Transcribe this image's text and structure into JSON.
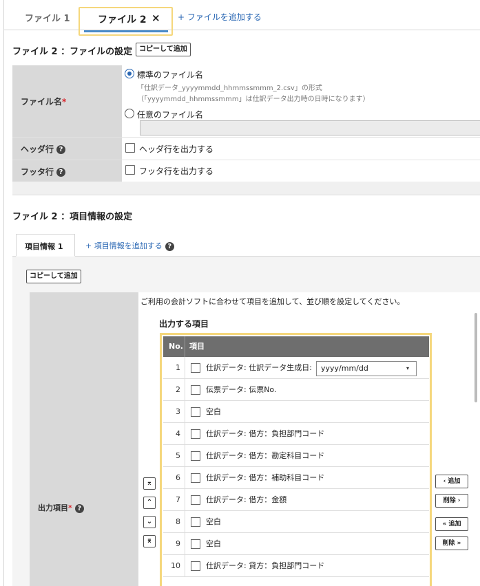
{
  "file_tabs": {
    "tab1": "ファイル 1",
    "tab2": "ファイル 2",
    "close_glyph": "×",
    "add_file": "+ ファイルを追加する"
  },
  "file_settings": {
    "title": "ファイル 2 ：ファイルの設定",
    "copy_button": "コピーして追加",
    "filename": {
      "label": "ファイル名",
      "required_mark": "*",
      "option_standard": "標準のファイル名",
      "standard_hint1": "「仕訳データ_yyyymmdd_hhmmssmmm_2.csv」の形式",
      "standard_hint2": "（「yyyymmdd_hhmmssmmm」は仕訳データ出力時の日時になります）",
      "option_custom": "任意のファイル名",
      "custom_value": ""
    },
    "header_row": {
      "label": "ヘッダ行",
      "checkbox_label": "ヘッダ行を出力する"
    },
    "footer_row": {
      "label": "フッタ行",
      "checkbox_label": "フッタ行を出力する"
    },
    "help_glyph": "?"
  },
  "item_settings": {
    "title": "ファイル 2 ：項目情報の設定",
    "tab1": "項目情報 1",
    "add_item": "+ 項目情報を追加する",
    "copy_button": "コピーして追加",
    "instruction": "ご利用の会計ソフトに合わせて項目を追加して、並び順を設定してください。",
    "output_label": "出力項目",
    "required_mark": "*",
    "output_heading": "出力する項目",
    "columns": {
      "no": "No.",
      "item": "項目"
    },
    "rows": [
      {
        "no": "1",
        "label": "仕訳データ: 仕訳データ生成日:",
        "select": "yyyy/mm/dd"
      },
      {
        "no": "2",
        "label": "伝票データ: 伝票No."
      },
      {
        "no": "3",
        "label": "空白"
      },
      {
        "no": "4",
        "label": "仕訳データ: 借方：負担部門コード"
      },
      {
        "no": "5",
        "label": "仕訳データ: 借方：勘定科目コード"
      },
      {
        "no": "6",
        "label": "仕訳データ: 借方：補助科目コード"
      },
      {
        "no": "7",
        "label": "仕訳データ: 借方：金額"
      },
      {
        "no": "8",
        "label": "空白"
      },
      {
        "no": "9",
        "label": "空白"
      },
      {
        "no": "10",
        "label": "仕訳データ: 貸方：負担部門コード"
      }
    ],
    "move_buttons": {
      "top": "⌅",
      "up": "⌃",
      "down": "⌄",
      "bottom": "⌆"
    },
    "side_buttons": {
      "add": "‹ 追加",
      "remove": "削除 ›",
      "add_all": "« 追加",
      "remove_all": "削除 »"
    },
    "select_caret": "▾"
  }
}
